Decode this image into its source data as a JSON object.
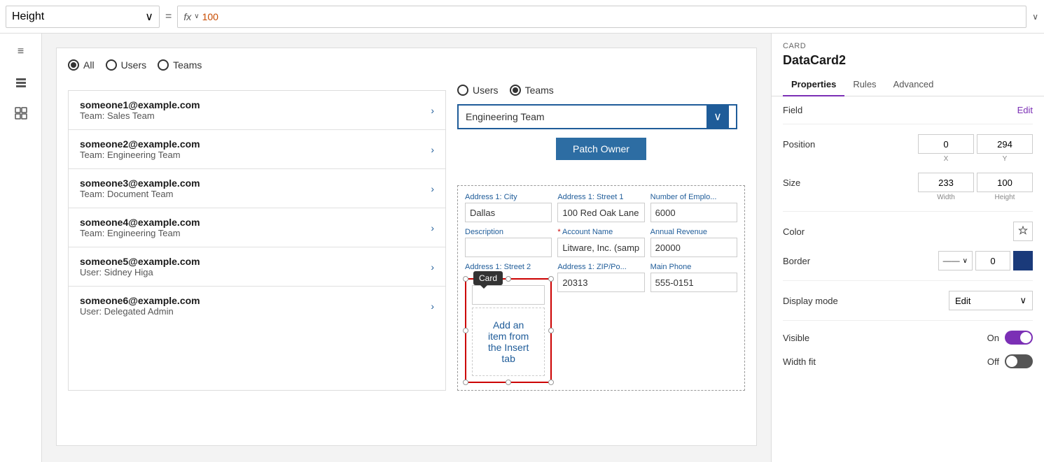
{
  "topbar": {
    "height_label": "Height",
    "equals": "=",
    "fx_label": "fx",
    "fx_value": "100",
    "chevron_down": "∨"
  },
  "sidebar": {
    "icons": [
      "≡",
      "⊞",
      "⊟"
    ]
  },
  "canvas": {
    "radio_group": {
      "options": [
        "All",
        "Users",
        "Teams"
      ],
      "selected": "All"
    },
    "users": [
      {
        "email": "someone1@example.com",
        "team": "Team: Sales Team"
      },
      {
        "email": "someone2@example.com",
        "team": "Team: Engineering Team"
      },
      {
        "email": "someone3@example.com",
        "team": "Team: Document Team"
      },
      {
        "email": "someone4@example.com",
        "team": "Team: Engineering Team"
      },
      {
        "email": "someone5@example.com",
        "team": "User: Sidney Higa"
      },
      {
        "email": "someone6@example.com",
        "team": "User: Delegated Admin"
      }
    ],
    "form": {
      "radio_options": [
        "Users",
        "Teams"
      ],
      "selected_radio": "Teams",
      "dropdown_value": "Engineering Team",
      "patch_btn": "Patch Owner",
      "data_fields": [
        {
          "label": "Address 1: City",
          "value": "Dallas",
          "required": false
        },
        {
          "label": "Address 1: Street 1",
          "value": "100 Red Oak Lane",
          "required": false
        },
        {
          "label": "Number of Emplo...",
          "value": "6000",
          "required": false
        },
        {
          "label": "Description",
          "value": "",
          "required": false
        },
        {
          "label": "Account Name",
          "value": "Litware, Inc. (sample",
          "required": true
        },
        {
          "label": "Annual Revenue",
          "value": "20000",
          "required": false
        },
        {
          "label": "Address 1: Street 2",
          "value": "",
          "required": false
        },
        {
          "label": "Address 1: ZIP/Po...",
          "value": "20313",
          "required": false
        },
        {
          "label": "Main Phone",
          "value": "555-0151",
          "required": false
        }
      ],
      "card_tooltip": "Card",
      "card_insert_text": "Add an item from\nthe Insert tab"
    }
  },
  "properties": {
    "section_label": "CARD",
    "title": "DataCard2",
    "tabs": [
      "Properties",
      "Rules",
      "Advanced"
    ],
    "active_tab": "Properties",
    "field_label": "Field",
    "edit_label": "Edit",
    "position_label": "Position",
    "position_x": "0",
    "position_y": "294",
    "x_label": "X",
    "y_label": "Y",
    "size_label": "Size",
    "size_width": "233",
    "size_height": "100",
    "width_label": "Width",
    "height_label": "Height",
    "color_label": "Color",
    "border_label": "Border",
    "border_value": "0",
    "display_mode_label": "Display mode",
    "display_mode_value": "Edit",
    "visible_label": "Visible",
    "visible_on": "On",
    "width_fit_label": "Width fit",
    "width_fit_off": "Off"
  }
}
